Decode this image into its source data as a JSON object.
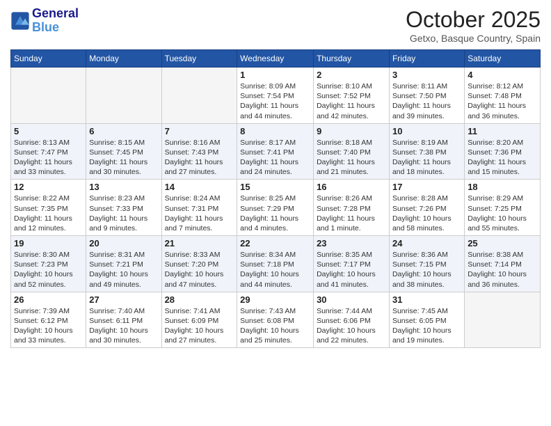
{
  "header": {
    "logo_line1": "General",
    "logo_line2": "Blue",
    "month": "October 2025",
    "location": "Getxo, Basque Country, Spain"
  },
  "days_of_week": [
    "Sunday",
    "Monday",
    "Tuesday",
    "Wednesday",
    "Thursday",
    "Friday",
    "Saturday"
  ],
  "weeks": [
    [
      {
        "day": "",
        "info": ""
      },
      {
        "day": "",
        "info": ""
      },
      {
        "day": "",
        "info": ""
      },
      {
        "day": "1",
        "info": "Sunrise: 8:09 AM\nSunset: 7:54 PM\nDaylight: 11 hours and 44 minutes."
      },
      {
        "day": "2",
        "info": "Sunrise: 8:10 AM\nSunset: 7:52 PM\nDaylight: 11 hours and 42 minutes."
      },
      {
        "day": "3",
        "info": "Sunrise: 8:11 AM\nSunset: 7:50 PM\nDaylight: 11 hours and 39 minutes."
      },
      {
        "day": "4",
        "info": "Sunrise: 8:12 AM\nSunset: 7:48 PM\nDaylight: 11 hours and 36 minutes."
      }
    ],
    [
      {
        "day": "5",
        "info": "Sunrise: 8:13 AM\nSunset: 7:47 PM\nDaylight: 11 hours and 33 minutes."
      },
      {
        "day": "6",
        "info": "Sunrise: 8:15 AM\nSunset: 7:45 PM\nDaylight: 11 hours and 30 minutes."
      },
      {
        "day": "7",
        "info": "Sunrise: 8:16 AM\nSunset: 7:43 PM\nDaylight: 11 hours and 27 minutes."
      },
      {
        "day": "8",
        "info": "Sunrise: 8:17 AM\nSunset: 7:41 PM\nDaylight: 11 hours and 24 minutes."
      },
      {
        "day": "9",
        "info": "Sunrise: 8:18 AM\nSunset: 7:40 PM\nDaylight: 11 hours and 21 minutes."
      },
      {
        "day": "10",
        "info": "Sunrise: 8:19 AM\nSunset: 7:38 PM\nDaylight: 11 hours and 18 minutes."
      },
      {
        "day": "11",
        "info": "Sunrise: 8:20 AM\nSunset: 7:36 PM\nDaylight: 11 hours and 15 minutes."
      }
    ],
    [
      {
        "day": "12",
        "info": "Sunrise: 8:22 AM\nSunset: 7:35 PM\nDaylight: 11 hours and 12 minutes."
      },
      {
        "day": "13",
        "info": "Sunrise: 8:23 AM\nSunset: 7:33 PM\nDaylight: 11 hours and 9 minutes."
      },
      {
        "day": "14",
        "info": "Sunrise: 8:24 AM\nSunset: 7:31 PM\nDaylight: 11 hours and 7 minutes."
      },
      {
        "day": "15",
        "info": "Sunrise: 8:25 AM\nSunset: 7:29 PM\nDaylight: 11 hours and 4 minutes."
      },
      {
        "day": "16",
        "info": "Sunrise: 8:26 AM\nSunset: 7:28 PM\nDaylight: 11 hours and 1 minute."
      },
      {
        "day": "17",
        "info": "Sunrise: 8:28 AM\nSunset: 7:26 PM\nDaylight: 10 hours and 58 minutes."
      },
      {
        "day": "18",
        "info": "Sunrise: 8:29 AM\nSunset: 7:25 PM\nDaylight: 10 hours and 55 minutes."
      }
    ],
    [
      {
        "day": "19",
        "info": "Sunrise: 8:30 AM\nSunset: 7:23 PM\nDaylight: 10 hours and 52 minutes."
      },
      {
        "day": "20",
        "info": "Sunrise: 8:31 AM\nSunset: 7:21 PM\nDaylight: 10 hours and 49 minutes."
      },
      {
        "day": "21",
        "info": "Sunrise: 8:33 AM\nSunset: 7:20 PM\nDaylight: 10 hours and 47 minutes."
      },
      {
        "day": "22",
        "info": "Sunrise: 8:34 AM\nSunset: 7:18 PM\nDaylight: 10 hours and 44 minutes."
      },
      {
        "day": "23",
        "info": "Sunrise: 8:35 AM\nSunset: 7:17 PM\nDaylight: 10 hours and 41 minutes."
      },
      {
        "day": "24",
        "info": "Sunrise: 8:36 AM\nSunset: 7:15 PM\nDaylight: 10 hours and 38 minutes."
      },
      {
        "day": "25",
        "info": "Sunrise: 8:38 AM\nSunset: 7:14 PM\nDaylight: 10 hours and 36 minutes."
      }
    ],
    [
      {
        "day": "26",
        "info": "Sunrise: 7:39 AM\nSunset: 6:12 PM\nDaylight: 10 hours and 33 minutes."
      },
      {
        "day": "27",
        "info": "Sunrise: 7:40 AM\nSunset: 6:11 PM\nDaylight: 10 hours and 30 minutes."
      },
      {
        "day": "28",
        "info": "Sunrise: 7:41 AM\nSunset: 6:09 PM\nDaylight: 10 hours and 27 minutes."
      },
      {
        "day": "29",
        "info": "Sunrise: 7:43 AM\nSunset: 6:08 PM\nDaylight: 10 hours and 25 minutes."
      },
      {
        "day": "30",
        "info": "Sunrise: 7:44 AM\nSunset: 6:06 PM\nDaylight: 10 hours and 22 minutes."
      },
      {
        "day": "31",
        "info": "Sunrise: 7:45 AM\nSunset: 6:05 PM\nDaylight: 10 hours and 19 minutes."
      },
      {
        "day": "",
        "info": ""
      }
    ]
  ]
}
